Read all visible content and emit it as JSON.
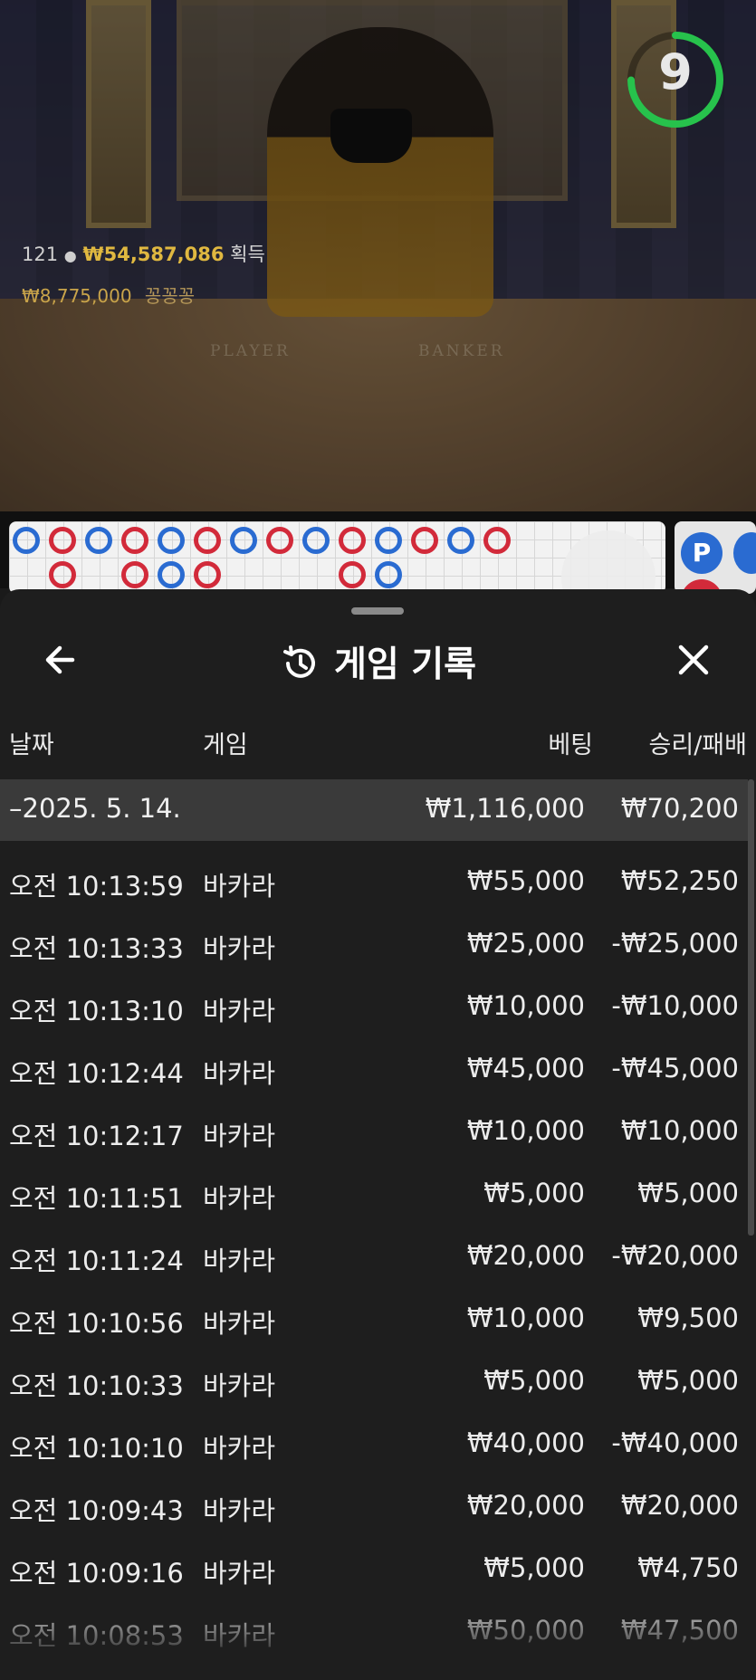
{
  "video": {
    "timer": "9",
    "players": "121",
    "pot_amount": "₩54,587,086",
    "pot_label": "획득",
    "top_win_amount": "₩8,775,000",
    "top_win_name": "꽁꽁꽁",
    "table_labels": {
      "player": "PLAYER",
      "banker": "BANKER"
    }
  },
  "sidebar_badge": "P",
  "sheet": {
    "title": "게임 기록",
    "columns": {
      "date": "날짜",
      "game": "게임",
      "bet": "베팅",
      "winloss": "승리/패배"
    },
    "summary": {
      "date": "–2025. 5. 14.",
      "bet": "₩1,116,000",
      "winloss": "₩70,200"
    },
    "rows": [
      {
        "time": "오전 10:13:59",
        "game": "바카라",
        "bet": "₩55,000",
        "winloss": "₩52,250"
      },
      {
        "time": "오전 10:13:33",
        "game": "바카라",
        "bet": "₩25,000",
        "winloss": "-₩25,000"
      },
      {
        "time": "오전 10:13:10",
        "game": "바카라",
        "bet": "₩10,000",
        "winloss": "-₩10,000"
      },
      {
        "time": "오전 10:12:44",
        "game": "바카라",
        "bet": "₩45,000",
        "winloss": "-₩45,000"
      },
      {
        "time": "오전 10:12:17",
        "game": "바카라",
        "bet": "₩10,000",
        "winloss": "₩10,000"
      },
      {
        "time": "오전 10:11:51",
        "game": "바카라",
        "bet": "₩5,000",
        "winloss": "₩5,000"
      },
      {
        "time": "오전 10:11:24",
        "game": "바카라",
        "bet": "₩20,000",
        "winloss": "-₩20,000"
      },
      {
        "time": "오전 10:10:56",
        "game": "바카라",
        "bet": "₩10,000",
        "winloss": "₩9,500"
      },
      {
        "time": "오전 10:10:33",
        "game": "바카라",
        "bet": "₩5,000",
        "winloss": "₩5,000"
      },
      {
        "time": "오전 10:10:10",
        "game": "바카라",
        "bet": "₩40,000",
        "winloss": "-₩40,000"
      },
      {
        "time": "오전 10:09:43",
        "game": "바카라",
        "bet": "₩20,000",
        "winloss": "₩20,000"
      },
      {
        "time": "오전 10:09:16",
        "game": "바카라",
        "bet": "₩5,000",
        "winloss": "₩4,750"
      },
      {
        "time": "오전 10:08:53",
        "game": "바카라",
        "bet": "₩50,000",
        "winloss": "₩47,500"
      }
    ]
  },
  "colors": {
    "timer_ring": "#27c24c",
    "gold": "#e0b840",
    "blue_bead": "#2a6bd1",
    "red_bead": "#d22a3a"
  }
}
